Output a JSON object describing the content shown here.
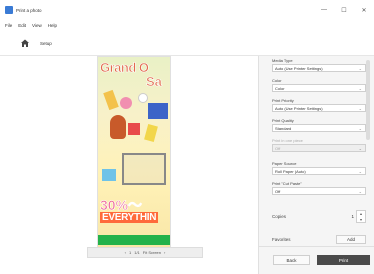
{
  "window": {
    "title": "Print a photo",
    "minimize": "—",
    "maximize": "☐",
    "close": "✕"
  },
  "menu": {
    "items": [
      "File",
      "Edit",
      "View",
      "Help"
    ]
  },
  "toolbar": {
    "crumb": "Setup"
  },
  "preview": {
    "poster_texts": [
      "Grand O",
      "Sa",
      "30%～",
      "EVERYTHIN"
    ],
    "pager": {
      "prev": "‹",
      "first": "1",
      "page_text": "1/1",
      "zoom": "Fit Screen",
      "next": "›"
    }
  },
  "settings": {
    "media_type": {
      "label": "Media Type",
      "value": "Auto (Use Printer Settings)"
    },
    "color": {
      "label": "Color",
      "value": "Color"
    },
    "print_priority": {
      "label": "Print Priority",
      "value": "Auto (Use Printer Settings)"
    },
    "print_quality": {
      "label": "Print Quality",
      "value": "Standard"
    },
    "print_disabled": {
      "label": "Print in one piece",
      "value": "Off"
    },
    "paper_source": {
      "label": "Paper Source",
      "value": "Roll Paper (Auto)"
    },
    "print_cut": {
      "label": "Print \"Cut Paste\"",
      "value": "Off"
    },
    "copies": {
      "label": "Copies",
      "value": "1"
    },
    "favorites": {
      "label": "Favorites",
      "button": "Add"
    },
    "back_button": "Back",
    "print_button": "Print"
  },
  "colors": {
    "print_button": "#4a4a4a",
    "poster_bar": "#24b24a"
  }
}
